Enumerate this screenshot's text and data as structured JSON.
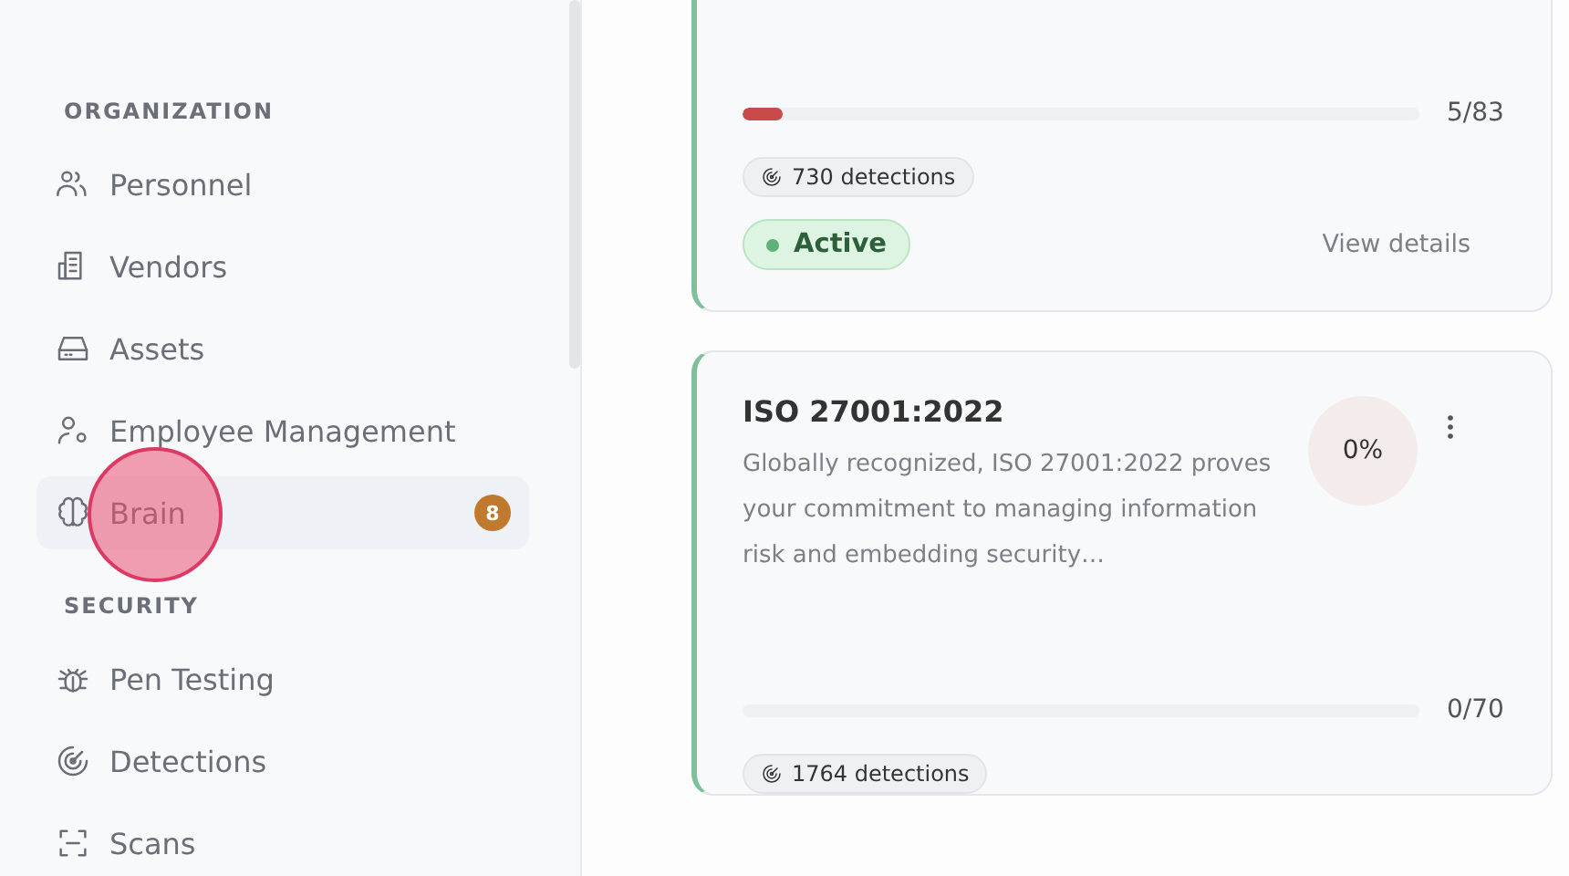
{
  "sidebar": {
    "sections": [
      {
        "title": "ORGANIZATION",
        "items": [
          {
            "label": "Personnel",
            "selected": false,
            "clicked": false
          },
          {
            "label": "Vendors",
            "selected": false,
            "clicked": false
          },
          {
            "label": "Assets",
            "selected": false,
            "clicked": false
          },
          {
            "label": "Employee Management",
            "selected": false,
            "clicked": false
          },
          {
            "label": "Brain",
            "selected": true,
            "clicked": true,
            "badge": "8"
          }
        ]
      },
      {
        "title": "SECURITY",
        "items": [
          {
            "label": "Pen Testing",
            "selected": false,
            "clicked": false
          },
          {
            "label": "Detections",
            "selected": false,
            "clicked": false
          },
          {
            "label": "Scans",
            "selected": false,
            "clicked": false
          }
        ]
      }
    ]
  },
  "cards": [
    {
      "progress": {
        "level": 0.06,
        "reading": "5/83"
      },
      "detections": "730 detections",
      "status": "Active",
      "link": "View details"
    },
    {
      "title": "ISO 27001:2022",
      "description": "Globally recognized, ISO 27001:2022 proves your commitment to managing information risk and embedding security…",
      "percent": "0%",
      "progress": {
        "level": 0,
        "reading": "0/70"
      },
      "detections": "1764 detections"
    }
  ]
}
